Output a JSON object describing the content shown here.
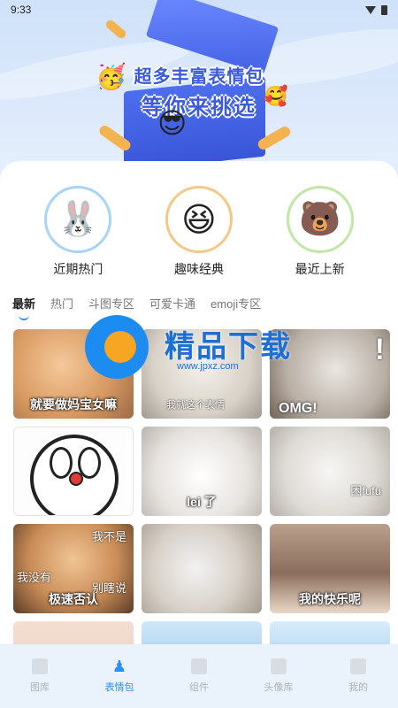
{
  "status": {
    "time": "9:33"
  },
  "banner": {
    "line1": "超多丰富表情包",
    "line2": "等你来挑选"
  },
  "categories": [
    {
      "label": "近期热门",
      "icon": "bunny-stickers-icon"
    },
    {
      "label": "趣味经典",
      "icon": "laughing-emoji-icon"
    },
    {
      "label": "最近上新",
      "icon": "bear-sticker-icon"
    }
  ],
  "tabs": [
    "最新",
    "热门",
    "斗图专区",
    "可爱卡通",
    "emoji专区"
  ],
  "grid": [
    {
      "caption": "就要做妈宝女嘛"
    },
    {
      "caption": "我就这个表情"
    },
    {
      "caption": "OMG!",
      "badge": "!"
    },
    {
      "caption": ""
    },
    {
      "caption": "lei 了"
    },
    {
      "caption": "困fufu"
    },
    {
      "caption_top": "我不是",
      "caption_left": "我没有",
      "caption_right": "别瞎说",
      "caption": "极速否认"
    },
    {
      "caption": ""
    },
    {
      "caption": "我的快乐呢"
    },
    {
      "caption": ""
    },
    {
      "caption": ""
    },
    {
      "caption": ""
    }
  ],
  "watermark": {
    "text": "精品下载",
    "url": "www.jpxz.com"
  },
  "bottom_nav": [
    {
      "label": "图库",
      "icon": "gallery-icon"
    },
    {
      "label": "表情包",
      "icon": "sticker-icon",
      "active": true
    },
    {
      "label": "组件",
      "icon": "widgets-icon"
    },
    {
      "label": "头像库",
      "icon": "avatar-library-icon"
    },
    {
      "label": "我的",
      "icon": "profile-icon"
    }
  ],
  "colors": {
    "accent": "#2f8ef4",
    "banner_text": "#3b5bdb"
  }
}
